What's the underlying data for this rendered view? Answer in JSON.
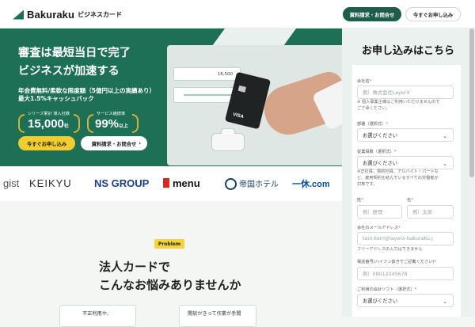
{
  "header": {
    "brand": "Bakuraku",
    "brand_suffix": "ビジネスカード",
    "documents_button": "資料請求・お問合せ",
    "apply_button": "今すぐお申し込み"
  },
  "hero": {
    "title_line1": "審査は最短当日で完了",
    "title_line2": "ビジネスが加速する",
    "subtitle_line1": "年会費無料/柔軟な限度額（5億円以上の実績あり）",
    "subtitle_line2": "最大1.5%キャッシュバック",
    "stat1": {
      "label": "シリーズ累計 導入社数",
      "value": "15,000",
      "unit": "社"
    },
    "stat2": {
      "label": "サービス継続率",
      "value": "99%",
      "unit": "以上"
    },
    "primary_cta": "今すぐお申し込み",
    "secondary_cta": "資料請求・お問合せ",
    "terminal_number": "16,500",
    "card_brand": "VISA"
  },
  "logos": [
    "gist",
    "KEIKYU",
    "NS GROUP",
    "menu",
    "帝国ホテル",
    "一休.com"
  ],
  "problem": {
    "badge": "Problem",
    "title_line1": "法人カードで",
    "title_line2": "こんなお悩みありませんか",
    "card1": "不正利用や、",
    "card2": "開放がきって作業が手間"
  },
  "form": {
    "title": "お申し込みはこちら",
    "company_label": "会社名",
    "company_placeholder": "例）株式会社LayerX",
    "company_note_line1": "※ 個人事業主様はご利用いただけませんので",
    "company_note_line2": "ご了承ください。",
    "department_label": "部署（選択式）",
    "department_value": "お選びください",
    "employees_label": "従業員数（選択式）",
    "employees_value": "お選びください",
    "employees_note_line1": "※正社員、契約社員、アルバイト・パートな",
    "employees_note_line2": "ど、雇用契約を結んでいるすべての労働者が",
    "employees_note_line3": "対象です。",
    "last_name_label": "姓",
    "last_name_placeholder": "例）経理",
    "first_name_label": "名",
    "first_name_placeholder": "例）太郎",
    "email_label": "会社のメールアドレス",
    "email_placeholder": "taro.keiri@layerx-bakuraku.j",
    "email_note": "フリーアドレスの入力はできません",
    "phone_label": "電話番号(ハイフン抜きでご記載ください)",
    "phone_placeholder": "例）08012345678",
    "accounting_label": "ご利用の会計ソフト（選択式）",
    "accounting_value": "お選びください"
  },
  "colors": {
    "green": "#1d6f55",
    "yellow": "#f2cd2f",
    "red_required": "#e14b3b"
  },
  "icons": {
    "select": "chevron-down-icon",
    "cta": "chevron-right-icon"
  }
}
